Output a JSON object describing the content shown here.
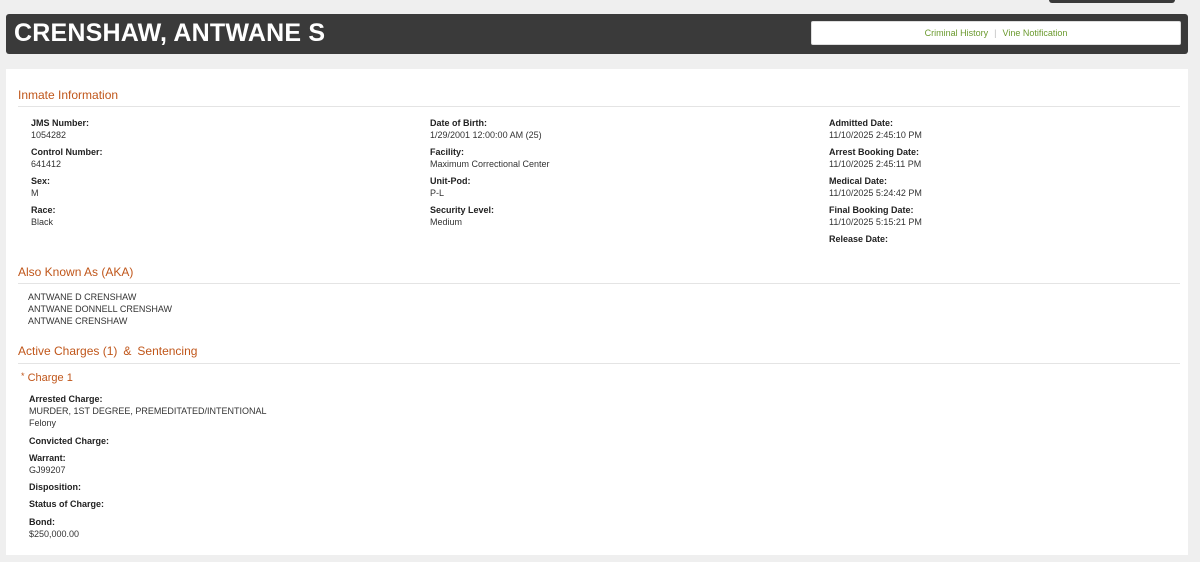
{
  "header": {
    "name": "CRENSHAW, ANTWANE S",
    "links": [
      "Criminal History",
      "Vine Notification"
    ]
  },
  "inmate_info": {
    "title": "Inmate Information",
    "col1": [
      {
        "label": "JMS Number:",
        "value": "1054282"
      },
      {
        "label": "Control Number:",
        "value": "641412"
      },
      {
        "label": "Sex:",
        "value": "M"
      },
      {
        "label": "Race:",
        "value": "Black"
      }
    ],
    "col2": [
      {
        "label": "Date of Birth:",
        "value": "1/29/2001 12:00:00 AM (25)"
      },
      {
        "label": "Facility:",
        "value": "Maximum Correctional Center"
      },
      {
        "label": "Unit-Pod:",
        "value": "P-L"
      },
      {
        "label": "Security Level:",
        "value": "Medium"
      }
    ],
    "col3": [
      {
        "label": "Admitted Date:",
        "value": "11/10/2025 2:45:10 PM"
      },
      {
        "label": "Arrest Booking Date:",
        "value": "11/10/2025 2:45:11 PM"
      },
      {
        "label": "Medical Date:",
        "value": "11/10/2025 5:24:42 PM"
      },
      {
        "label": "Final Booking Date:",
        "value": "11/10/2025 5:15:21 PM"
      },
      {
        "label": "Release Date:",
        "value": ""
      }
    ]
  },
  "aka": {
    "title": "Also Known As (AKA)",
    "names": [
      "ANTWANE D CRENSHAW",
      "ANTWANE DONNELL CRENSHAW",
      "ANTWANE CRENSHAW"
    ]
  },
  "charges": {
    "title_left": "Active Charges (1)",
    "amp": "&",
    "title_right": "Sentencing",
    "charge_star": "*",
    "charge_title": "Charge 1",
    "arrested_label": "Arrested Charge:",
    "arrested_value": "MURDER, 1ST DEGREE, PREMEDITATED/INTENTIONAL",
    "arrested_class": "Felony",
    "convicted_label": "Convicted Charge:",
    "warrant_label": "Warrant:",
    "warrant_value": "GJ99207",
    "disposition_label": "Disposition:",
    "status_label": "Status of Charge:",
    "bond_label": "Bond:",
    "bond_value": "$250,000.00"
  },
  "colors": {
    "header_bg": "#3a3a3a",
    "section_accent": "#c0561a",
    "link": "#6b9a2e"
  }
}
